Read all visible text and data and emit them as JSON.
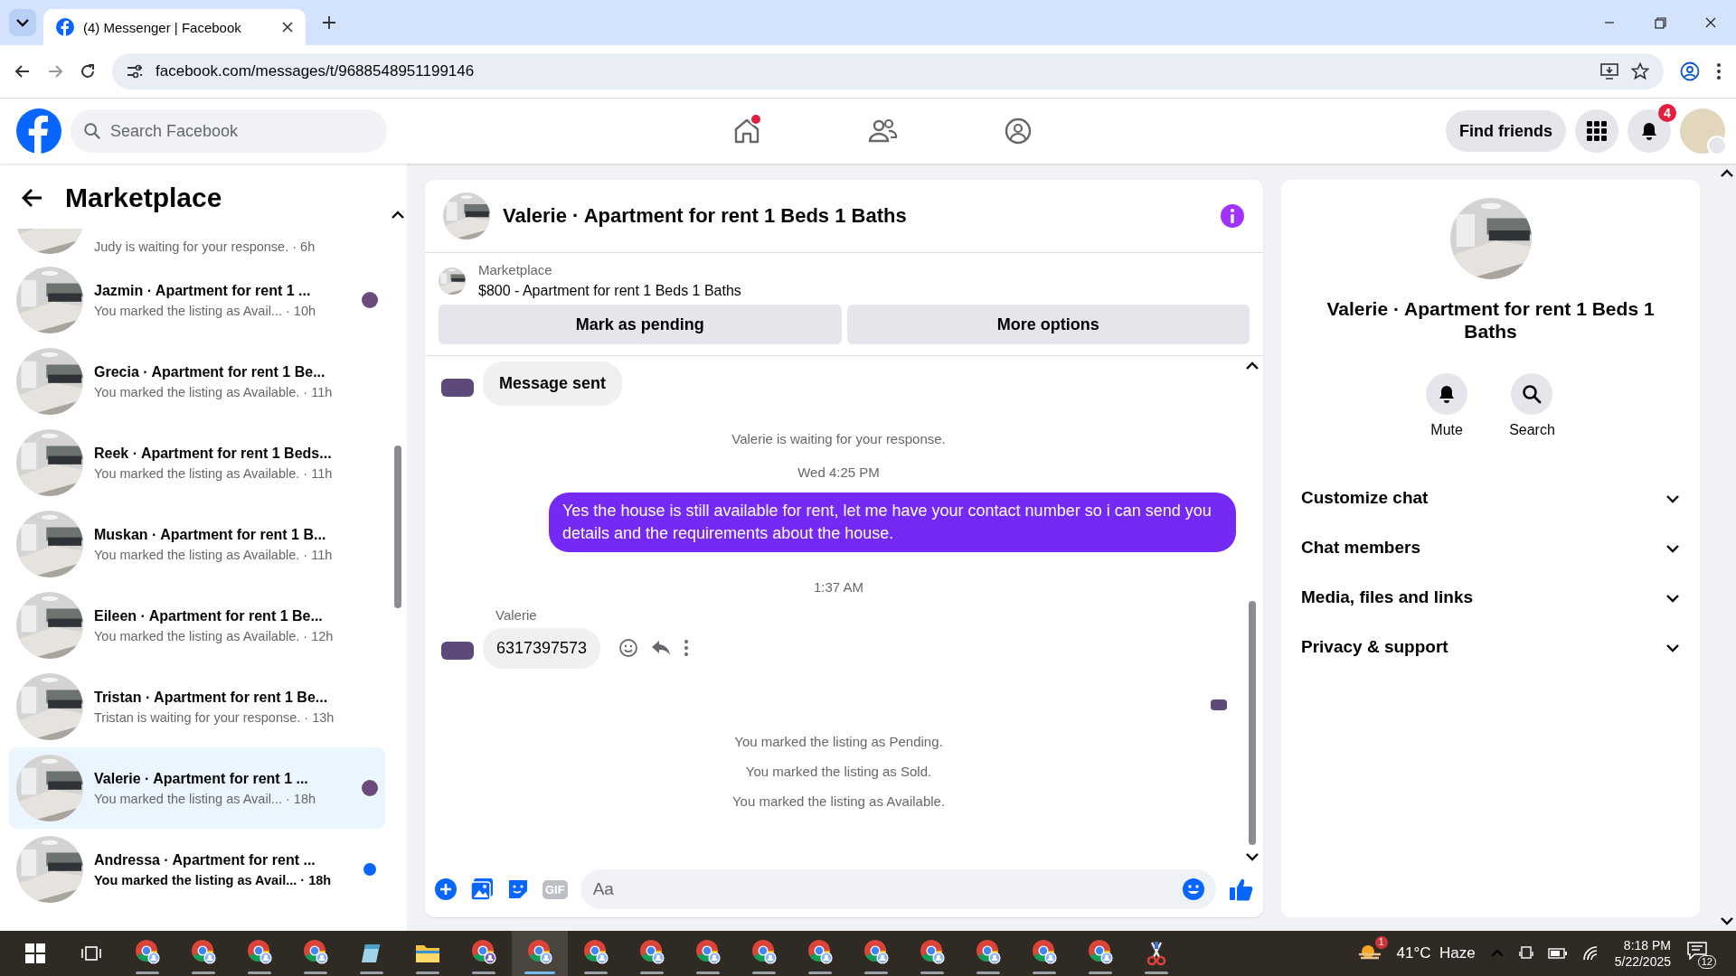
{
  "browser": {
    "tab_title": "(4) Messenger | Facebook",
    "url": "facebook.com/messages/t/9688548951199146"
  },
  "header": {
    "search_placeholder": "Search Facebook",
    "nav": [
      {
        "kind": "home",
        "alert": true
      },
      {
        "kind": "friends",
        "alert": false
      },
      {
        "kind": "groups",
        "alert": false
      }
    ],
    "find_friends": "Find friends",
    "notification_count": "4"
  },
  "sidebar": {
    "title": "Marketplace",
    "conversations": [
      {
        "subtitle": "Judy is waiting for your response. · 6h",
        "unread": false,
        "selected": false,
        "seen": false
      },
      {
        "title": "Jazmin · Apartment for rent 1 ...",
        "subtitle": "You marked the listing as Avail...  · 10h",
        "unread": false,
        "selected": false,
        "seen": true
      },
      {
        "title": "Grecia · Apartment for rent 1 Be...",
        "subtitle": "You marked the listing as Available. · 11h",
        "unread": false,
        "selected": false,
        "seen": false
      },
      {
        "title": "Reek · Apartment for rent 1 Beds...",
        "subtitle": "You marked the listing as Available. · 11h",
        "unread": false,
        "selected": false,
        "seen": false
      },
      {
        "title": "Muskan · Apartment for rent 1 B...",
        "subtitle": "You marked the listing as Available. · 11h",
        "unread": false,
        "selected": false,
        "seen": false
      },
      {
        "title": "Eileen · Apartment for rent 1 Be...",
        "subtitle": "You marked the listing as Available. · 12h",
        "unread": false,
        "selected": false,
        "seen": false
      },
      {
        "title": "Tristan · Apartment for rent 1 Be...",
        "subtitle": "Tristan is waiting for your response. · 13h",
        "unread": false,
        "selected": false,
        "seen": false
      },
      {
        "title": "Valerie · Apartment for rent 1 ...",
        "subtitle": "You marked the listing as Avail...  · 18h",
        "unread": false,
        "selected": true,
        "seen": true
      },
      {
        "title": "Andressa · Apartment for rent ...",
        "subtitle": "You marked the listing as Avail... · 18h",
        "unread": true,
        "selected": false,
        "seen": false
      }
    ]
  },
  "chat": {
    "title": "Valerie · Apartment for rent 1 Beds 1 Baths",
    "listing": {
      "source": "Marketplace",
      "summary": "$800 - Apartment for rent 1 Beds 1 Baths"
    },
    "actions": [
      "Mark as pending",
      "More options"
    ],
    "messages": [
      {
        "kind": "status_bubble",
        "text": "Message sent"
      },
      {
        "kind": "notice",
        "text": "Valerie is waiting for your response."
      },
      {
        "kind": "time",
        "text": "Wed 4:25 PM"
      },
      {
        "kind": "outgoing",
        "text": "Yes the house is still available for rent, let me have your contact number so i can send you details and the requirements about the house."
      },
      {
        "kind": "time",
        "text": "1:37 AM"
      },
      {
        "kind": "incoming",
        "sender": "Valerie",
        "text": "6317397573"
      },
      {
        "kind": "seen"
      },
      {
        "kind": "notice",
        "text": "You marked the listing as Pending."
      },
      {
        "kind": "notice",
        "text": "You marked the listing as Sold."
      },
      {
        "kind": "notice",
        "text": "You marked the listing as Available."
      }
    ],
    "composer": {
      "gif_label": "GIF",
      "placeholder": "Aa"
    }
  },
  "details": {
    "title": "Valerie · Apartment for rent 1 Beds 1 Baths",
    "actions": [
      {
        "kind": "bell",
        "label": "Mute"
      },
      {
        "kind": "search",
        "label": "Search"
      }
    ],
    "sections": [
      {
        "label": "Customize chat",
        "expanded": false
      },
      {
        "label": "Chat members",
        "expanded": false
      },
      {
        "label": "Media, files and links",
        "expanded": false
      },
      {
        "label": "Privacy & support",
        "expanded": false
      }
    ]
  },
  "taskbar": {
    "apps": [
      {
        "kind": "chrome",
        "active": false
      },
      {
        "kind": "chrome",
        "active": false
      },
      {
        "kind": "chrome",
        "active": false
      },
      {
        "kind": "chrome",
        "active": false
      },
      {
        "kind": "notes",
        "active": false
      },
      {
        "kind": "folder",
        "active": false
      },
      {
        "kind": "chrome_s",
        "active": false
      },
      {
        "kind": "chrome",
        "active": true
      },
      {
        "kind": "chrome",
        "active": false
      },
      {
        "kind": "chrome",
        "active": false
      },
      {
        "kind": "chrome",
        "active": false
      },
      {
        "kind": "chrome",
        "active": false
      },
      {
        "kind": "chrome",
        "active": false
      },
      {
        "kind": "chrome",
        "active": false
      },
      {
        "kind": "chrome",
        "active": false
      },
      {
        "kind": "chrome",
        "active": false
      },
      {
        "kind": "chrome",
        "active": false
      },
      {
        "kind": "chrome",
        "active": false
      },
      {
        "kind": "snip",
        "active": false
      }
    ],
    "weather_badge": "1",
    "weather": "41°C  Haze",
    "time": "8:18 PM",
    "date": "5/22/2025",
    "notifications": "12"
  }
}
